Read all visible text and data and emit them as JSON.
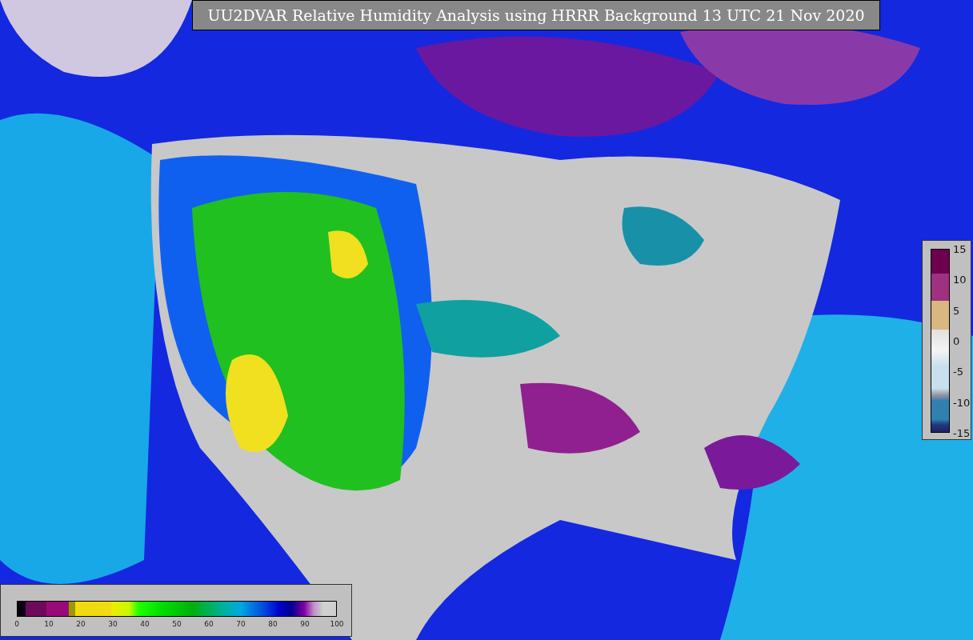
{
  "title": "UU2DVAR Relative Humidity Analysis using HRRR Background 13 UTC 21 Nov 2020",
  "humidity_colorbar": {
    "ticks": [
      "0",
      "10",
      "20",
      "30",
      "40",
      "50",
      "60",
      "70",
      "80",
      "90",
      "100"
    ]
  },
  "difference_colorbar": {
    "ticks": [
      "15",
      "10",
      "5",
      "0",
      "-5",
      "-10",
      "-15"
    ]
  }
}
